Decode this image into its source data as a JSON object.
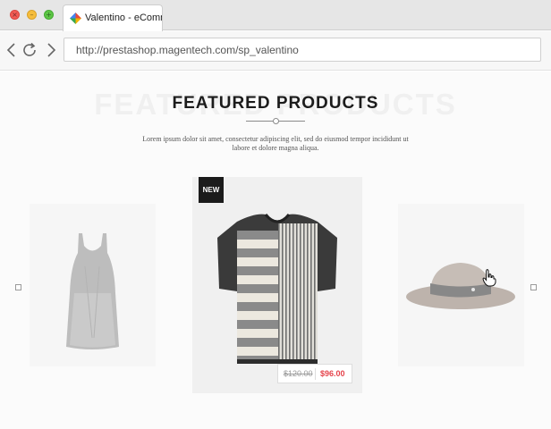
{
  "browser": {
    "tab_title": "Valentino - eCommerce",
    "url": "http://prestashop.magentech.com/sp_valentino",
    "icons": {
      "close": "close-icon",
      "minimize": "minimize-icon",
      "maximize": "maximize-icon",
      "back": "back-arrow-icon",
      "reload": "reload-icon",
      "forward": "forward-arrow-icon"
    }
  },
  "section": {
    "ghost_title": "FEATURED PRODUCTS",
    "title": "FEATURED PRODUCTS",
    "description": "Lorem ipsum dolor sit amet, consectetur adipiscing elit, sed do eiusmod tempor incididunt ut labore et dolore magna aliqua."
  },
  "products": [
    {
      "image": "grey tank dress"
    },
    {
      "image": "striped t-shirt",
      "badge": "NEW",
      "old_price": "$120.00",
      "price": "$96.00"
    },
    {
      "image": "taupe fedora hat"
    }
  ],
  "colors": {
    "price": "#e5434b",
    "badge": "#1b1b1b"
  }
}
